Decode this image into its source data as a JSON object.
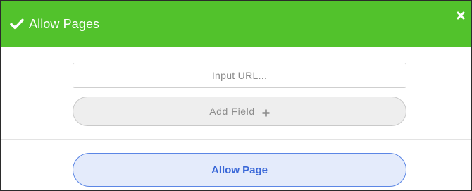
{
  "header": {
    "title": "Allow Pages",
    "check_icon": "check-icon",
    "close_icon": "close-icon",
    "background_color": "#52c22c"
  },
  "form": {
    "url_placeholder": "Input URL...",
    "url_value": "",
    "add_field_label": "Add Field",
    "add_field_icon": "plus-icon"
  },
  "footer": {
    "allow_button_label": "Allow Page",
    "accent_color": "#3a68d8"
  }
}
